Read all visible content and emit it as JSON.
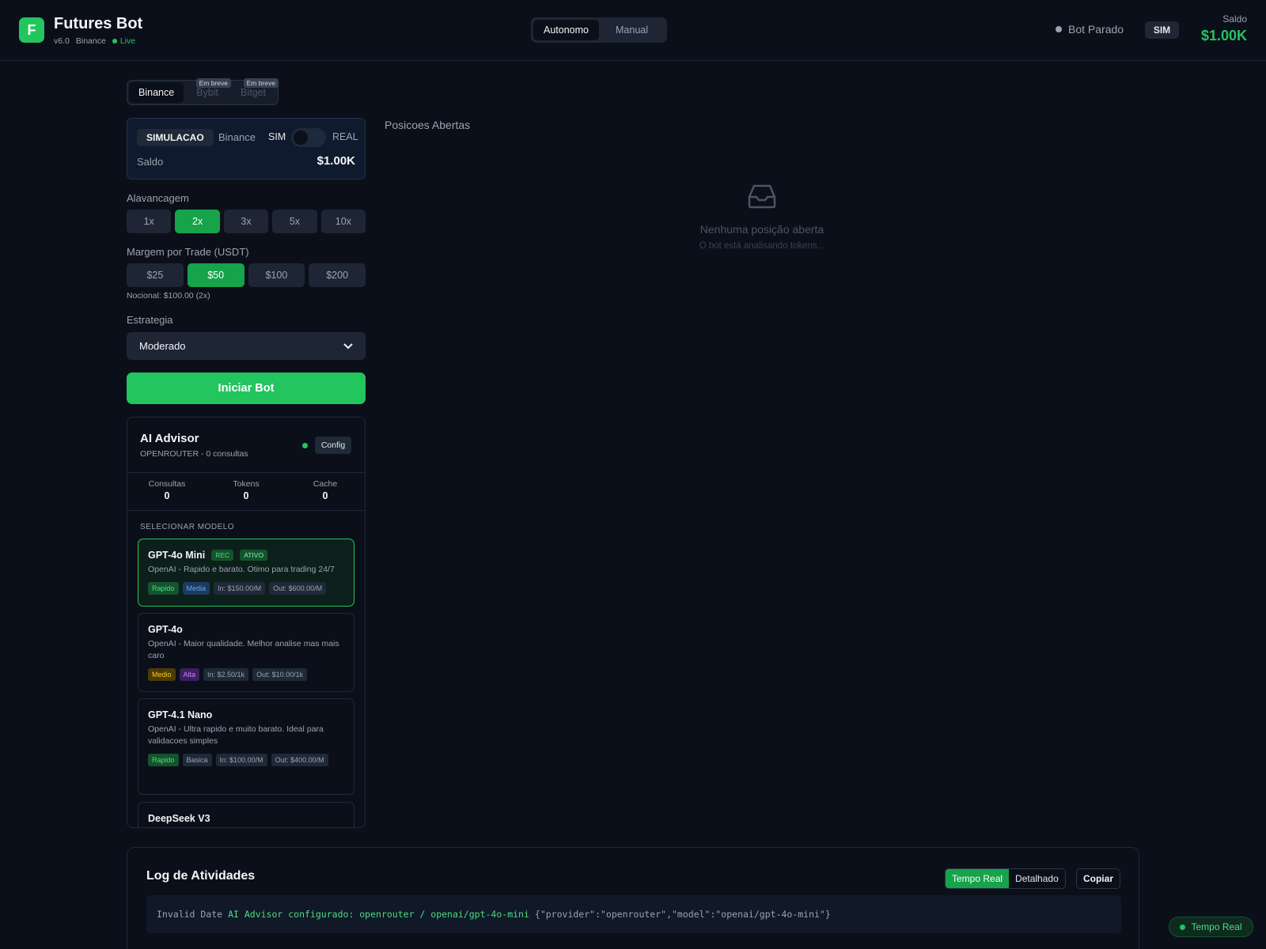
{
  "app": {
    "logo_letter": "F",
    "title": "Futures Bot",
    "version": "v6.0",
    "exchange": "Binance",
    "live": "Live"
  },
  "header": {
    "modes": [
      "Autonomo",
      "Manual"
    ],
    "bot_status": "Bot Parado",
    "mode_badge": "SIM",
    "saldo_label": "Saldo",
    "saldo_value": "$1.00K"
  },
  "exchanges": {
    "tabs": [
      "Binance",
      "Bybit",
      "Bitget"
    ],
    "soon": "Em breve"
  },
  "account": {
    "mode": "SIMULACAO",
    "exchange": "Binance",
    "sim": "SIM",
    "real": "REAL",
    "saldo_label": "Saldo",
    "saldo_value": "$1.00K"
  },
  "leverage": {
    "label": "Alavancagem",
    "options": [
      "1x",
      "2x",
      "3x",
      "5x",
      "10x"
    ],
    "selected": "2x"
  },
  "margin": {
    "label": "Margem por Trade (USDT)",
    "options": [
      "$25",
      "$50",
      "$100",
      "$200"
    ],
    "selected": "$50",
    "nocional": "Nocional: $100.00 (2x)"
  },
  "strategy": {
    "label": "Estrategia",
    "value": "Moderado"
  },
  "start_button": "Iniciar Bot",
  "advisor": {
    "title": "AI Advisor",
    "subtitle": "OPENROUTER - 0 consultas",
    "config": "Config",
    "stats": [
      {
        "label": "Consultas",
        "value": "0"
      },
      {
        "label": "Tokens",
        "value": "0"
      },
      {
        "label": "Cache",
        "value": "0"
      }
    ],
    "select_label": "SELECIONAR MODELO",
    "models": [
      {
        "name": "GPT-4o Mini",
        "badges": [
          "REC",
          "ATIVO"
        ],
        "desc": "OpenAI - Rapido e barato. Otimo para trading 24/7",
        "tags": [
          "Rapido",
          "Media",
          "In: $150.00/M",
          "Out: $600.00/M"
        ]
      },
      {
        "name": "GPT-4o",
        "desc": "OpenAI - Maior qualidade. Melhor analise mas mais caro",
        "tags": [
          "Medio",
          "Alta",
          "In: $2.50/1k",
          "Out: $10.00/1k"
        ]
      },
      {
        "name": "GPT-4.1 Nano",
        "desc": "OpenAI - Ultra rapido e muito barato. Ideal para validacoes simples",
        "tags": [
          "Rapido",
          "Basica",
          "In: $100.00/M",
          "Out: $400.00/M"
        ]
      },
      {
        "name": "DeepSeek V3"
      }
    ]
  },
  "positions": {
    "title": "Posicoes Abertas",
    "empty_icon": "inbox-icon",
    "empty_title": "Nenhuma posição aberta",
    "empty_sub": "O bot está analisando tokens..."
  },
  "log": {
    "title": "Log de Atividades",
    "tabs": [
      "Tempo Real",
      "Detalhado"
    ],
    "copy": "Copiar",
    "entry": {
      "date": "Invalid Date",
      "message": "AI Advisor configurado: openrouter / openai/gpt-4o-mini",
      "json": "{\"provider\":\"openrouter\",\"model\":\"openai/gpt-4o-mini\"}"
    }
  },
  "realtime_badge": "Tempo Real",
  "colors": {
    "accent": "#22c55e",
    "background": "#0b0f19",
    "card": "#1e2636"
  }
}
